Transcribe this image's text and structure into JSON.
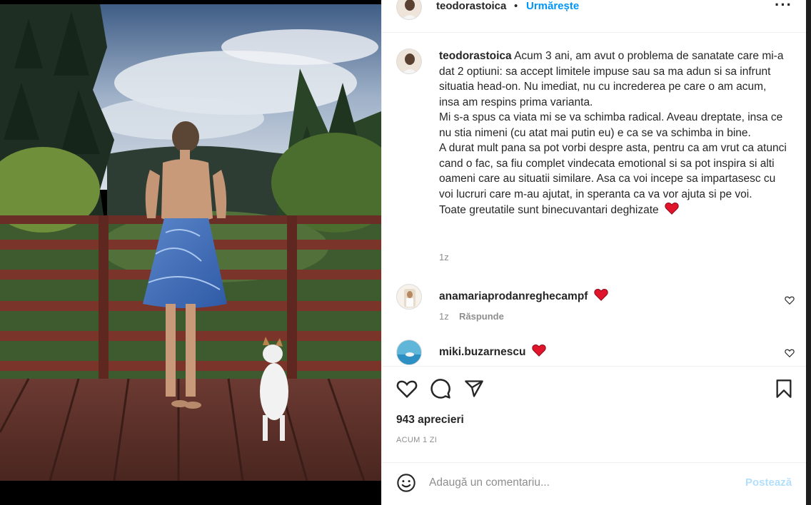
{
  "post": {
    "username": "teodorastoica",
    "separator": "•",
    "follow_label": "Urmărește",
    "more_icon": "more-horizontal-icon"
  },
  "caption": {
    "username": "teodorastoica",
    "lines": [
      "Acum 3 ani, am avut o problema de sanatate care mi-a dat 2 optiuni: sa accept limitele impuse sau sa ma adun si sa infrunt situatia head-on. Nu imediat, nu cu increderea pe care o am acum, insa am respins prima varianta.",
      "Mi s-a spus ca viata mi se va schimba radical. Aveau dreptate, insa ce nu stia nimeni (cu atat mai putin eu) e ca se va schimba in bine.",
      "A durat mult pana sa pot vorbi despre asta, pentru ca am vrut ca atunci cand o fac, sa fiu complet vindecata emotional si sa pot inspira si alti oameni care au situatii similare. Asa ca voi incepe sa impartasesc cu voi lucruri care m-au ajutat, in speranta ca va vor ajuta si pe voi.",
      "Toate greutatile sunt binecuvantari deghizate"
    ],
    "time": "1z"
  },
  "comments": [
    {
      "username": "anamariaprodanreghecampf",
      "time": "1z",
      "reply_label": "Răspunde"
    },
    {
      "username": "miki.buzarnescu"
    }
  ],
  "likes_text": "943 aprecieri",
  "date_text": "ACUM 1 ZI",
  "add_comment": {
    "placeholder": "Adaugă un comentariu...",
    "post_label": "Postează"
  },
  "colors": {
    "accent": "#0095f6",
    "heart": "#ed4956",
    "post_disabled": "#b2dffc"
  }
}
